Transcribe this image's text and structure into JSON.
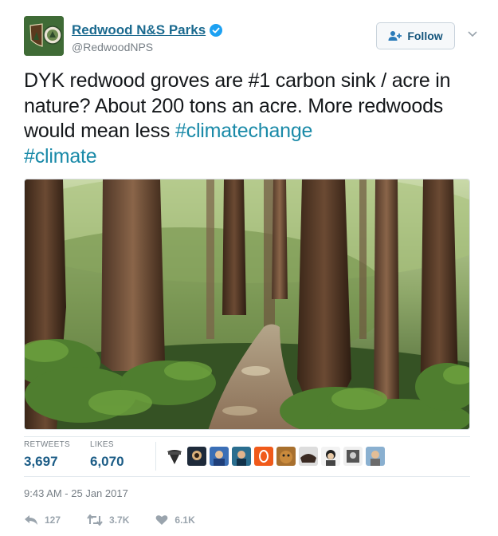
{
  "account": {
    "display_name": "Redwood N&S Parks",
    "handle": "@RedwoodNPS",
    "verified": true
  },
  "follow_label": "Follow",
  "tweet": {
    "text_plain": "DYK redwood groves are #1 carbon sink / acre in nature? About 200 tons an acre. More redwoods would mean less ",
    "hashtag_1": "#climatechange",
    "hashtag_2": "#climate"
  },
  "stats": {
    "retweets_label": "RETWEETS",
    "retweets_value": "3,697",
    "likes_label": "LIKES",
    "likes_value": "6,070"
  },
  "timestamp": "9:43 AM - 25 Jan 2017",
  "actions": {
    "reply_count": "127",
    "retweet_count": "3.7K",
    "like_count": "6.1K"
  },
  "colors": {
    "link": "#1a8aa8",
    "name": "#1b6a8f",
    "verified": "#1da1f2",
    "stat_value": "#1b5c86"
  }
}
